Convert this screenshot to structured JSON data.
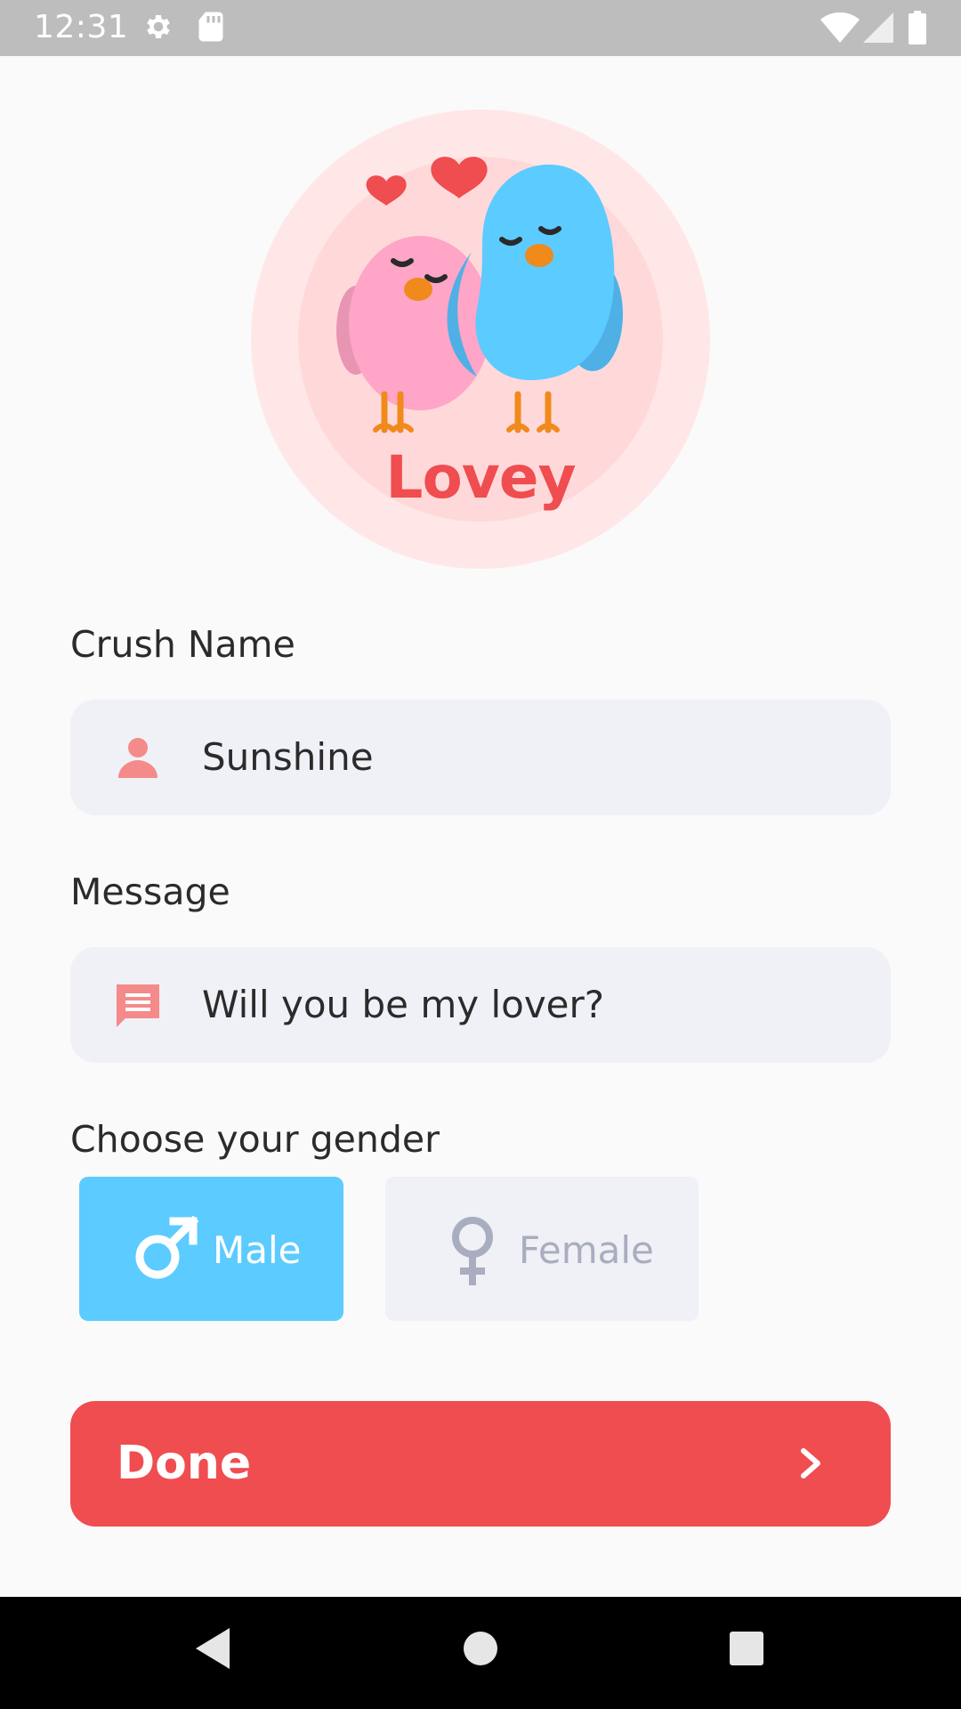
{
  "status_bar": {
    "time": "12:31",
    "icons": [
      "gear-icon",
      "sd-card-icon",
      "wifi-icon",
      "signal-icon",
      "battery-icon"
    ]
  },
  "logo": {
    "text": "Lovey",
    "colors": {
      "pink_bird": "#ffa5c7",
      "blue_bird": "#5ccbff",
      "heart": "#ef4d50"
    }
  },
  "form": {
    "crush_name": {
      "label": "Crush Name",
      "value": "Sunshine",
      "icon": "person-icon"
    },
    "message": {
      "label": "Message",
      "value": "Will you be my lover?",
      "icon": "chat-icon"
    },
    "gender": {
      "label": "Choose your gender",
      "options": [
        {
          "label": "Male",
          "icon": "male-icon",
          "selected": true
        },
        {
          "label": "Female",
          "icon": "female-icon",
          "selected": false
        }
      ]
    },
    "submit": {
      "label": "Done",
      "icon": "chevron-right-icon"
    }
  },
  "nav_bar": {
    "buttons": [
      "back-icon",
      "home-icon",
      "recents-icon"
    ]
  },
  "colors": {
    "accent": "#ef4d50",
    "male_selected": "#5ccbff",
    "field_bg": "#f0f1f6",
    "icon_pink": "#f48a8a"
  }
}
